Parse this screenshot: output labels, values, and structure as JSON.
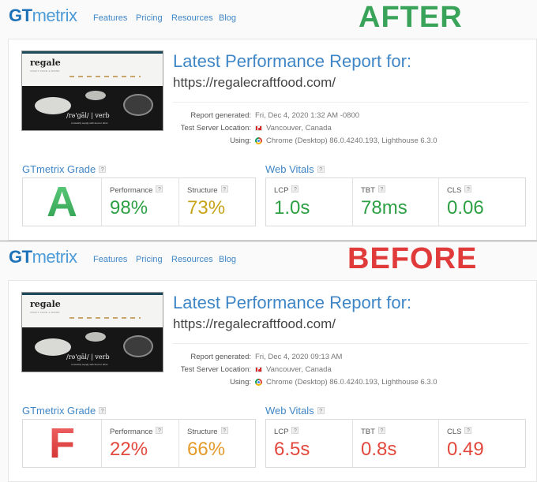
{
  "nav": {
    "logo_prefix": "GT",
    "logo_suffix": "metrix",
    "features": "Features",
    "pricing": "Pricing",
    "resources": "Resources",
    "blog": "Blog"
  },
  "thumbnail": {
    "brand": "regale",
    "brand_sub": "CRAFT FOOD & DRINK",
    "slogan": "/rə'gāl/ | verb",
    "slogan_sub": "to lavishly supply with food or drink"
  },
  "labels": {
    "report_title": "Latest Performance Report for:",
    "report_generated": "Report generated:",
    "test_server_location": "Test Server Location:",
    "using": "Using:",
    "gtmetrix_grade": "GTmetrix Grade",
    "web_vitals": "Web Vitals",
    "performance": "Performance",
    "structure": "Structure",
    "lcp": "LCP",
    "tbt": "TBT",
    "cls": "CLS",
    "help": "?"
  },
  "after": {
    "stamp": "AFTER",
    "url": "https://regalecraftfood.com/",
    "report_generated": "Fri, Dec 4, 2020 1:32 AM -0800",
    "location": "Vancouver, Canada",
    "using": "Chrome (Desktop) 86.0.4240.193, Lighthouse 6.3.0",
    "grade": "A",
    "performance": "98%",
    "structure": "73%",
    "lcp": "1.0s",
    "tbt": "78ms",
    "cls": "0.06"
  },
  "before": {
    "stamp": "BEFORE",
    "url": "https://regalecraftfood.com/",
    "report_generated": "Fri, Dec 4, 2020 09:13 AM",
    "location": "Vancouver, Canada",
    "using": "Chrome (Desktop) 86.0.4240.193, Lighthouse 6.3.0",
    "grade": "F",
    "performance": "22%",
    "structure": "66%",
    "lcp": "6.5s",
    "tbt": "0.8s",
    "cls": "0.49"
  },
  "colors": {
    "brand_blue": "#3f86c6",
    "after_stamp": "#3aa35a",
    "before_stamp": "#e03a3a",
    "good": "#2ea044",
    "average": "#c8a31a",
    "poor": "#e2483d",
    "warn": "#e49b2a"
  },
  "icons": [
    "canada-flag-icon",
    "chrome-icon",
    "help-icon"
  ]
}
